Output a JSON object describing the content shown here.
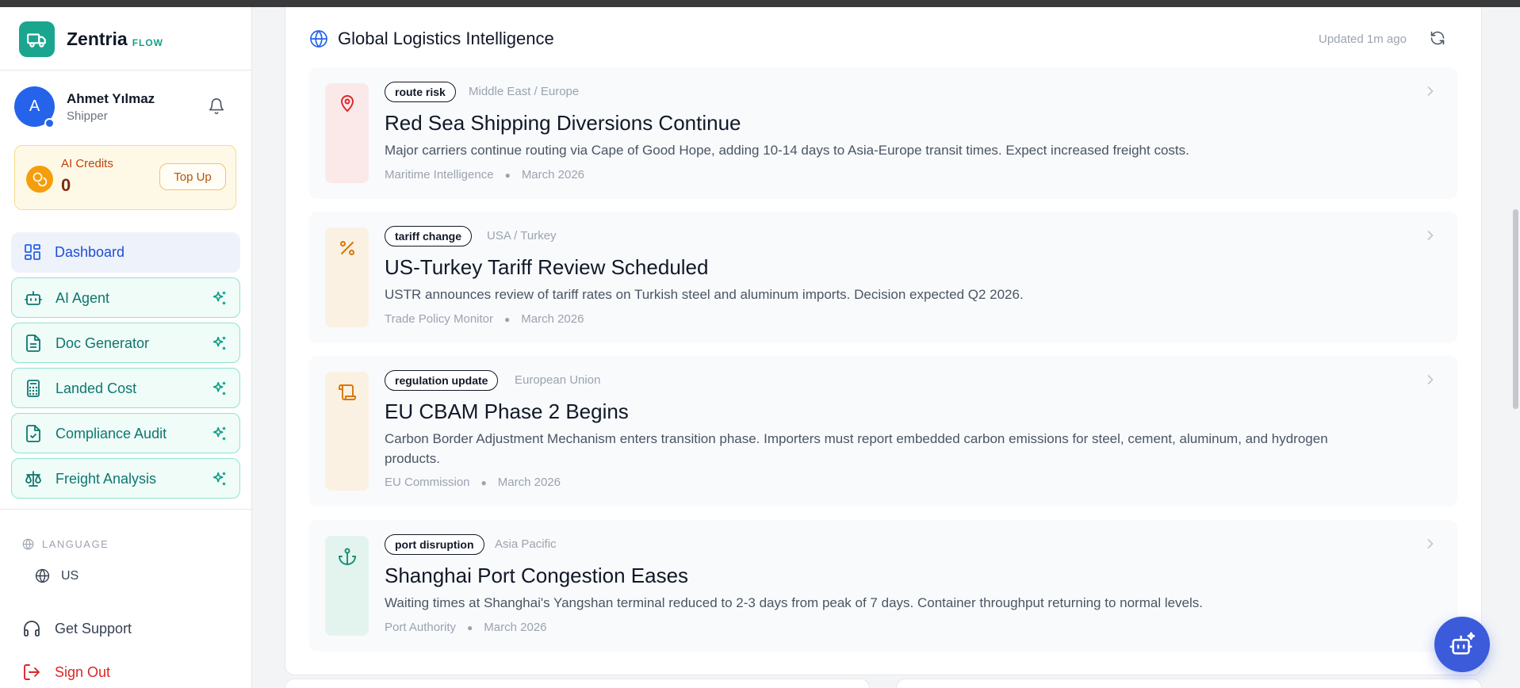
{
  "brand": {
    "name": "Zentria",
    "sub": "FLOW"
  },
  "user": {
    "initial": "A",
    "name": "Ahmet Yılmaz",
    "role": "Shipper"
  },
  "credits": {
    "label": "AI Credits",
    "value": "0",
    "topup_label": "Top Up"
  },
  "nav": [
    {
      "label": "Dashboard",
      "icon": "dashboard-icon",
      "active": true
    },
    {
      "label": "AI Agent",
      "icon": "robot-icon"
    },
    {
      "label": "Doc Generator",
      "icon": "document-icon"
    },
    {
      "label": "Landed Cost",
      "icon": "calculator-icon"
    },
    {
      "label": "Compliance Audit",
      "icon": "file-check-icon"
    },
    {
      "label": "Freight Analysis",
      "icon": "scale-icon"
    }
  ],
  "language": {
    "heading": "LANGUAGE",
    "current": "US"
  },
  "footer": {
    "support": "Get Support",
    "signout": "Sign Out"
  },
  "panel": {
    "title": "Global Logistics Intelligence",
    "updated": "Updated 1m ago"
  },
  "news": [
    {
      "tag": "route risk",
      "region": "Middle East / Europe",
      "title": "Red Sea Shipping Diversions Continue",
      "description": "Major carriers continue routing via Cape of Good Hope, adding 10-14 days to Asia-Europe transit times. Expect increased freight costs.",
      "source": "Maritime Intelligence",
      "date": "March 2026",
      "icon": "map-pin-icon",
      "tint": "#fbe9ea",
      "icon_color": "#dc2626"
    },
    {
      "tag": "tariff change",
      "region": "USA / Turkey",
      "title": "US-Turkey Tariff Review Scheduled",
      "description": "USTR announces review of tariff rates on Turkish steel and aluminum imports. Decision expected Q2 2026.",
      "source": "Trade Policy Monitor",
      "date": "March 2026",
      "icon": "percent-icon",
      "tint": "#fbf1e2",
      "icon_color": "#d97706"
    },
    {
      "tag": "regulation update",
      "region": "European Union",
      "title": "EU CBAM Phase 2 Begins",
      "description": "Carbon Border Adjustment Mechanism enters transition phase. Importers must report embedded carbon emissions for steel, cement, aluminum, and hydrogen products.",
      "source": "EU Commission",
      "date": "March 2026",
      "icon": "scroll-icon",
      "tint": "#fbf1e2",
      "icon_color": "#d97706"
    },
    {
      "tag": "port disruption",
      "region": "Asia Pacific",
      "title": "Shanghai Port Congestion Eases",
      "description": "Waiting times at Shanghai's Yangshan terminal reduced to 2-3 days from peak of 7 days. Container throughput returning to normal levels.",
      "source": "Port Authority",
      "date": "March 2026",
      "icon": "anchor-icon",
      "tint": "#e3f4ef",
      "icon_color": "#0f8f6e"
    }
  ]
}
